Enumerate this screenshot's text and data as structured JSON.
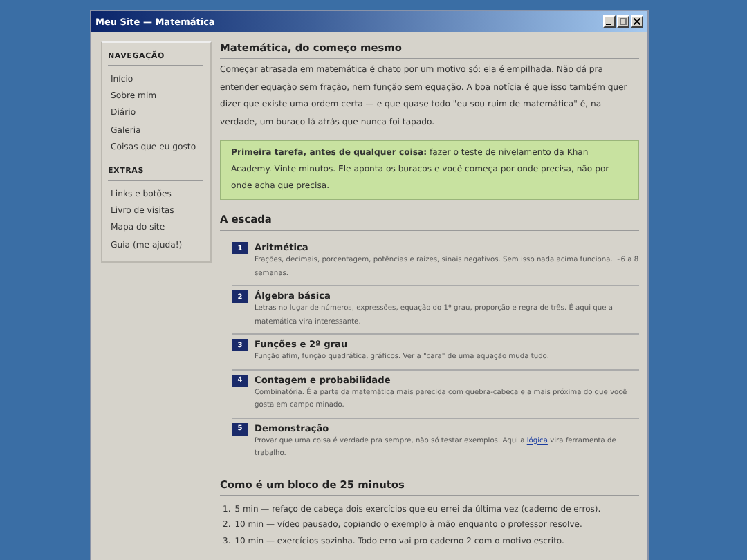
{
  "window": {
    "title": "Meu Site — Matemática"
  },
  "sidebar": {
    "sections": [
      {
        "heading": "NAVEGAÇÃO",
        "items": [
          "Início",
          "Sobre mim",
          "Diário",
          "Galeria",
          "Coisas que eu gosto"
        ]
      },
      {
        "heading": "EXTRAS",
        "items": [
          "Links e botões",
          "Livro de visitas",
          "Mapa do site",
          "Guia (me ajuda!)"
        ]
      }
    ]
  },
  "article": {
    "title": "Matemática, do começo mesmo",
    "intro": "Começar atrasada em matemática é chato por um motivo só: ela é empilhada. Não dá pra entender equação sem fração, nem função sem equação. A boa notícia é que isso também quer dizer que existe uma ordem certa — e que quase todo \"eu sou ruim de matemática\" é, na verdade, um buraco lá atrás que nunca foi tapado.",
    "callout": "**Primeira tarefa, antes de qualquer coisa:** fazer o teste de nivelamento da Khan Academy. Vinte minutos. Ele aponta os buracos e você começa por onde precisa, não por onde acha que precisa.",
    "steps_heading": "A escada",
    "steps": [
      {
        "number": "1",
        "title": "Aritmética",
        "desc": "Frações, decimais, porcentagem, potências e raízes, sinais negativos. Sem isso nada acima funciona. ~6 a 8 semanas."
      },
      {
        "number": "2",
        "title": "Álgebra básica",
        "desc": "Letras no lugar de números, expressões, equação do 1º grau, proporção e regra de três. É aqui que a matemática vira interessante."
      },
      {
        "number": "3",
        "title": "Funções e 2º grau",
        "desc": "Função afim, função quadrática, gráficos. Ver a \"cara\" de uma equação muda tudo."
      },
      {
        "number": "4",
        "title": "Contagem e probabilidade",
        "desc": "Combinatória. É a parte da matemática mais parecida com quebra-cabeça e a mais próxima do que você gosta em campo minado."
      },
      {
        "number": "5",
        "title": "Demonstração",
        "desc": "Provar que uma coisa é verdade pra sempre, não só testar exemplos. Aqui a ",
        "link": "lógica",
        "desc_after": " vira ferramenta de trabalho."
      }
    ],
    "block_heading": "Como é um bloco de 25 minutos",
    "block_items": [
      {
        "number": "1.",
        "text": "5 min — refaço de cabeça dois exercícios que eu errei da última vez (caderno de erros)."
      },
      {
        "number": "2.",
        "text": "10 min — vídeo pausado, copiando o exemplo à mão enquanto o professor resolve."
      },
      {
        "number": "3.",
        "text": "10 min — exercícios sozinha. Todo erro vai pro caderno 2 com o motivo escrito."
      }
    ]
  }
}
